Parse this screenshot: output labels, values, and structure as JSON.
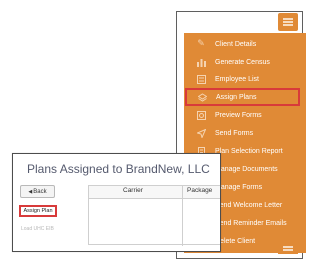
{
  "side_menu": {
    "toggle_icon": "hamburger-icon",
    "items": [
      {
        "label": "Client Details",
        "icon": "pencil-icon"
      },
      {
        "label": "Generate Census",
        "icon": "bar-chart-icon"
      },
      {
        "label": "Employee List",
        "icon": "list-icon"
      },
      {
        "label": "Assign Plans",
        "icon": "layers-icon",
        "highlighted": true
      },
      {
        "label": "Preview Forms",
        "icon": "preview-icon"
      },
      {
        "label": "Send Forms",
        "icon": "send-icon"
      },
      {
        "label": "Plan Selection Report",
        "icon": "report-icon"
      },
      {
        "label": "Manage Documents",
        "icon": "documents-icon"
      },
      {
        "label": "Manage Forms",
        "icon": "forms-icon"
      },
      {
        "label": "Send Welcome Letter",
        "icon": "letter-icon"
      },
      {
        "label": "Send Reminder Emails",
        "icon": "email-icon"
      },
      {
        "label": "Delete Client",
        "icon": "trash-icon"
      }
    ]
  },
  "plans_panel": {
    "title": "Plans Assigned to BrandNew, LLC",
    "back_label": "Back",
    "assign_label": "Assign Plan",
    "faint_link": "Load UHC EIB",
    "columns": [
      "Carrier",
      "Package"
    ]
  },
  "colors": {
    "menu_orange": "#e08a36",
    "highlight_red": "#d83a3a"
  }
}
